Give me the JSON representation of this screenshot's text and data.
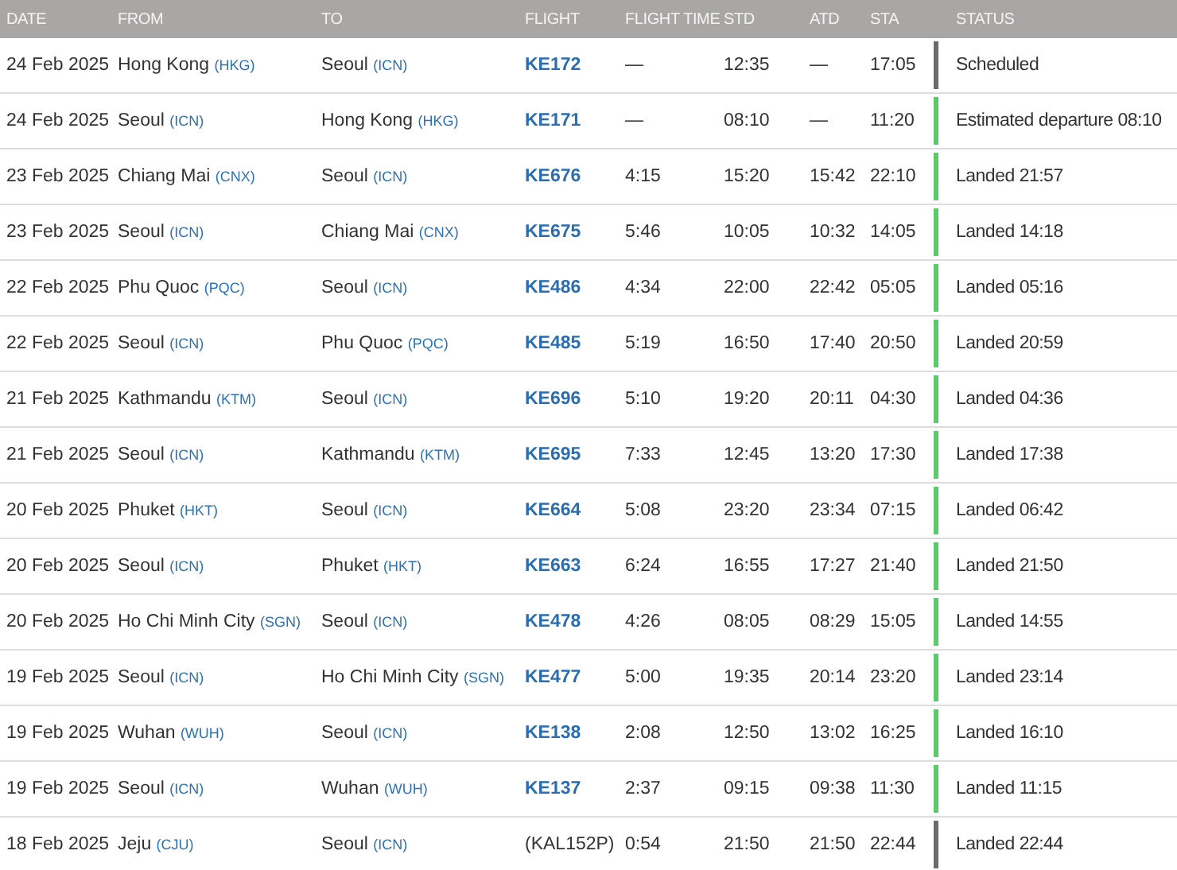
{
  "table": {
    "columns": [
      "DATE",
      "FROM",
      "TO",
      "FLIGHT",
      "FLIGHT TIME",
      "STD",
      "ATD",
      "STA",
      "STATUS"
    ],
    "rows": [
      {
        "date": "24 Feb 2025",
        "from": {
          "city": "Hong Kong",
          "code": "(HKG)"
        },
        "to": {
          "city": "Seoul",
          "code": "(ICN)"
        },
        "flight": {
          "number": "KE172",
          "kind": "link"
        },
        "flight_time": "—",
        "std": "12:35",
        "atd": "—",
        "sta": "17:05",
        "status": {
          "text": "Scheduled",
          "color": "#6b6b6b"
        }
      },
      {
        "date": "24 Feb 2025",
        "from": {
          "city": "Seoul",
          "code": "(ICN)"
        },
        "to": {
          "city": "Hong Kong",
          "code": "(HKG)"
        },
        "flight": {
          "number": "KE171",
          "kind": "link"
        },
        "flight_time": "—",
        "std": "08:10",
        "atd": "—",
        "sta": "11:20",
        "status": {
          "text": "Estimated departure 08:10",
          "color": "#5cc96a"
        }
      },
      {
        "date": "23 Feb 2025",
        "from": {
          "city": "Chiang Mai",
          "code": "(CNX)"
        },
        "to": {
          "city": "Seoul",
          "code": "(ICN)"
        },
        "flight": {
          "number": "KE676",
          "kind": "link"
        },
        "flight_time": "4:15",
        "std": "15:20",
        "atd": "15:42",
        "sta": "22:10",
        "status": {
          "text": "Landed 21:57",
          "color": "#5cc96a"
        }
      },
      {
        "date": "23 Feb 2025",
        "from": {
          "city": "Seoul",
          "code": "(ICN)"
        },
        "to": {
          "city": "Chiang Mai",
          "code": "(CNX)"
        },
        "flight": {
          "number": "KE675",
          "kind": "link"
        },
        "flight_time": "5:46",
        "std": "10:05",
        "atd": "10:32",
        "sta": "14:05",
        "status": {
          "text": "Landed 14:18",
          "color": "#5cc96a"
        }
      },
      {
        "date": "22 Feb 2025",
        "from": {
          "city": "Phu Quoc",
          "code": "(PQC)"
        },
        "to": {
          "city": "Seoul",
          "code": "(ICN)"
        },
        "flight": {
          "number": "KE486",
          "kind": "link"
        },
        "flight_time": "4:34",
        "std": "22:00",
        "atd": "22:42",
        "sta": "05:05",
        "status": {
          "text": "Landed 05:16",
          "color": "#5cc96a"
        }
      },
      {
        "date": "22 Feb 2025",
        "from": {
          "city": "Seoul",
          "code": "(ICN)"
        },
        "to": {
          "city": "Phu Quoc",
          "code": "(PQC)"
        },
        "flight": {
          "number": "KE485",
          "kind": "link"
        },
        "flight_time": "5:19",
        "std": "16:50",
        "atd": "17:40",
        "sta": "20:50",
        "status": {
          "text": "Landed 20:59",
          "color": "#5cc96a"
        }
      },
      {
        "date": "21 Feb 2025",
        "from": {
          "city": "Kathmandu",
          "code": "(KTM)"
        },
        "to": {
          "city": "Seoul",
          "code": "(ICN)"
        },
        "flight": {
          "number": "KE696",
          "kind": "link"
        },
        "flight_time": "5:10",
        "std": "19:20",
        "atd": "20:11",
        "sta": "04:30",
        "status": {
          "text": "Landed 04:36",
          "color": "#5cc96a"
        }
      },
      {
        "date": "21 Feb 2025",
        "from": {
          "city": "Seoul",
          "code": "(ICN)"
        },
        "to": {
          "city": "Kathmandu",
          "code": "(KTM)"
        },
        "flight": {
          "number": "KE695",
          "kind": "link"
        },
        "flight_time": "7:33",
        "std": "12:45",
        "atd": "13:20",
        "sta": "17:30",
        "status": {
          "text": "Landed 17:38",
          "color": "#5cc96a"
        }
      },
      {
        "date": "20 Feb 2025",
        "from": {
          "city": "Phuket",
          "code": "(HKT)"
        },
        "to": {
          "city": "Seoul",
          "code": "(ICN)"
        },
        "flight": {
          "number": "KE664",
          "kind": "link"
        },
        "flight_time": "5:08",
        "std": "23:20",
        "atd": "23:34",
        "sta": "07:15",
        "status": {
          "text": "Landed 06:42",
          "color": "#5cc96a"
        }
      },
      {
        "date": "20 Feb 2025",
        "from": {
          "city": "Seoul",
          "code": "(ICN)"
        },
        "to": {
          "city": "Phuket",
          "code": "(HKT)"
        },
        "flight": {
          "number": "KE663",
          "kind": "link"
        },
        "flight_time": "6:24",
        "std": "16:55",
        "atd": "17:27",
        "sta": "21:40",
        "status": {
          "text": "Landed 21:50",
          "color": "#5cc96a"
        }
      },
      {
        "date": "20 Feb 2025",
        "from": {
          "city": "Ho Chi Minh City",
          "code": "(SGN)"
        },
        "to": {
          "city": "Seoul",
          "code": "(ICN)"
        },
        "flight": {
          "number": "KE478",
          "kind": "link"
        },
        "flight_time": "4:26",
        "std": "08:05",
        "atd": "08:29",
        "sta": "15:05",
        "status": {
          "text": "Landed 14:55",
          "color": "#5cc96a"
        }
      },
      {
        "date": "19 Feb 2025",
        "from": {
          "city": "Seoul",
          "code": "(ICN)"
        },
        "to": {
          "city": "Ho Chi Minh City",
          "code": "(SGN)"
        },
        "flight": {
          "number": "KE477",
          "kind": "link"
        },
        "flight_time": "5:00",
        "std": "19:35",
        "atd": "20:14",
        "sta": "23:20",
        "status": {
          "text": "Landed 23:14",
          "color": "#5cc96a"
        }
      },
      {
        "date": "19 Feb 2025",
        "from": {
          "city": "Wuhan",
          "code": "(WUH)"
        },
        "to": {
          "city": "Seoul",
          "code": "(ICN)"
        },
        "flight": {
          "number": "KE138",
          "kind": "link"
        },
        "flight_time": "2:08",
        "std": "12:50",
        "atd": "13:02",
        "sta": "16:25",
        "status": {
          "text": "Landed 16:10",
          "color": "#5cc96a"
        }
      },
      {
        "date": "19 Feb 2025",
        "from": {
          "city": "Seoul",
          "code": "(ICN)"
        },
        "to": {
          "city": "Wuhan",
          "code": "(WUH)"
        },
        "flight": {
          "number": "KE137",
          "kind": "link"
        },
        "flight_time": "2:37",
        "std": "09:15",
        "atd": "09:38",
        "sta": "11:30",
        "status": {
          "text": "Landed 11:15",
          "color": "#5cc96a"
        }
      },
      {
        "date": "18 Feb 2025",
        "from": {
          "city": "Jeju",
          "code": "(CJU)"
        },
        "to": {
          "city": "Seoul",
          "code": "(ICN)"
        },
        "flight": {
          "number": "(KAL152P)",
          "kind": "plain"
        },
        "flight_time": "0:54",
        "std": "21:50",
        "atd": "21:50",
        "sta": "22:44",
        "status": {
          "text": "Landed 22:44",
          "color": "#6b6b6b"
        }
      }
    ]
  }
}
